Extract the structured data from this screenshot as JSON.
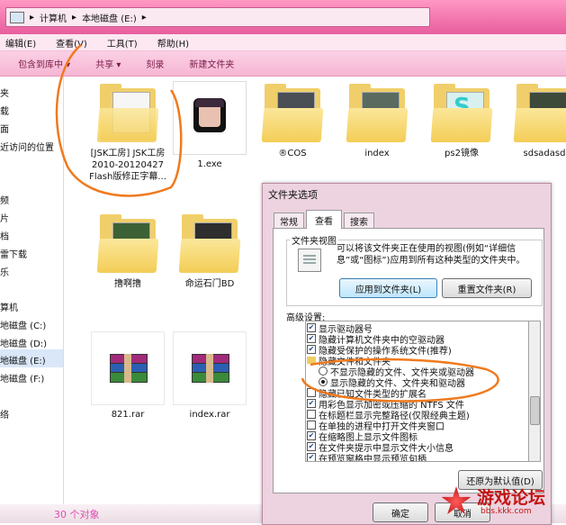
{
  "address": {
    "crumbs": [
      "计算机",
      "本地磁盘 (E:)"
    ]
  },
  "menu": {
    "items": [
      "编辑(E)",
      "查看(V)",
      "工具(T)",
      "帮助(H)"
    ]
  },
  "toolbar": {
    "items": [
      "包含到库中 ▾",
      "共享 ▾",
      "刻录",
      "新建文件夹"
    ]
  },
  "nav": {
    "items": [
      "夹",
      "载",
      "面",
      "近访问的位置",
      "频",
      "片",
      "档",
      "雷下载",
      "乐",
      "算机",
      "地磁盘 (C:)",
      "地磁盘 (D:)",
      "地磁盘 (E:)",
      "地磁盘 (F:)",
      "络"
    ]
  },
  "files": [
    {
      "label": "[JSK工房] JSK工房 2010-20120427 Flash版修正字幕...",
      "kind": "folder"
    },
    {
      "label": "1.exe",
      "kind": "exe"
    },
    {
      "label": "®COS",
      "kind": "folder"
    },
    {
      "label": "index",
      "kind": "folder"
    },
    {
      "label": "ps2镜像",
      "kind": "folder"
    },
    {
      "label": "sdsadasd",
      "kind": "folder"
    },
    {
      "label": "撸啊撸",
      "kind": "folder"
    },
    {
      "label": "命运石门BD",
      "kind": "folder"
    },
    {
      "label": "821.rar",
      "kind": "rar"
    },
    {
      "label": "index.rar",
      "kind": "rar"
    }
  ],
  "status": {
    "count": "30 个对象"
  },
  "dialog": {
    "title": "文件夹选项",
    "tabs": [
      "常规",
      "查看",
      "搜索"
    ],
    "group_title": "文件夹视图",
    "view_desc": "可以将该文件夹正在使用的视图(例如“详细信息”或“图标”)应用到所有这种类型的文件夹中。",
    "apply_btn": "应用到文件夹(L)",
    "reset_btn": "重置文件夹(R)",
    "advanced_label": "高级设置:",
    "tree": [
      {
        "type": "check",
        "checked": true,
        "label": "显示驱动器号"
      },
      {
        "type": "check",
        "checked": true,
        "label": "隐藏计算机文件夹中的空驱动器"
      },
      {
        "type": "check",
        "checked": true,
        "label": "隐藏受保护的操作系统文件(推荐)"
      },
      {
        "type": "folder",
        "label": "隐藏文件和文件夹"
      },
      {
        "type": "radio",
        "checked": false,
        "label": "不显示隐藏的文件、文件夹或驱动器"
      },
      {
        "type": "radio",
        "checked": true,
        "label": "显示隐藏的文件、文件夹和驱动器"
      },
      {
        "type": "check",
        "checked": false,
        "label": "隐藏已知文件类型的扩展名"
      },
      {
        "type": "check",
        "checked": true,
        "label": "用彩色显示加密或压缩的 NTFS 文件"
      },
      {
        "type": "check",
        "checked": false,
        "label": "在标题栏显示完整路径(仅限经典主题)"
      },
      {
        "type": "check",
        "checked": false,
        "label": "在单独的进程中打开文件夹窗口"
      },
      {
        "type": "check",
        "checked": true,
        "label": "在缩略图上显示文件图标"
      },
      {
        "type": "check",
        "checked": true,
        "label": "在文件夹提示中显示文件大小信息"
      },
      {
        "type": "check",
        "checked": true,
        "label": "在预览窗格中显示预览句柄"
      }
    ],
    "restore_btn": "还原为默认值(D)",
    "ok_btn": "确定",
    "cancel_btn": "取消"
  },
  "watermark": {
    "text": "游戏论坛",
    "url": "bbs.kkk.com"
  }
}
